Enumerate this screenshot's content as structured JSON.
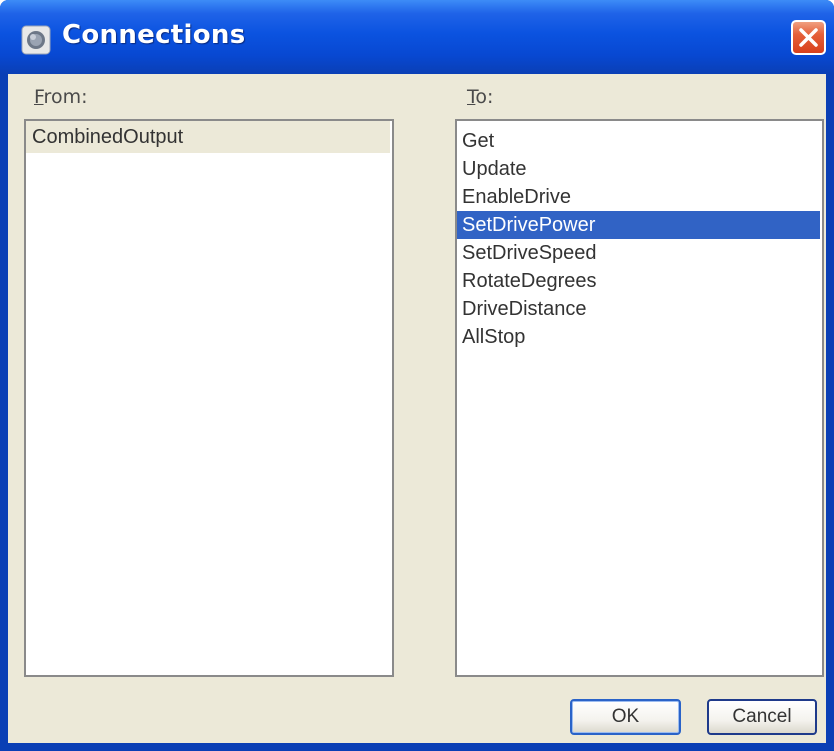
{
  "window": {
    "title": "Connections",
    "title_icon": "gear-icon",
    "close_icon": "close-icon"
  },
  "from": {
    "label_mnemonic": "F",
    "label_rest": "rom:",
    "items": [
      "CombinedOutput"
    ]
  },
  "to": {
    "label_mnemonic": "T",
    "label_rest": "o:",
    "items": [
      "Get",
      "Update",
      "EnableDrive",
      "SetDrivePower",
      "SetDriveSpeed",
      "RotateDegrees",
      "DriveDistance",
      "AllStop"
    ],
    "selected": "SetDrivePower"
  },
  "buttons": {
    "ok_label": "OK",
    "cancel_label": "Cancel"
  },
  "colors": {
    "titlebar": "#0b53e0",
    "selection": "#3163c5",
    "dialog_face": "#ece9d8"
  }
}
